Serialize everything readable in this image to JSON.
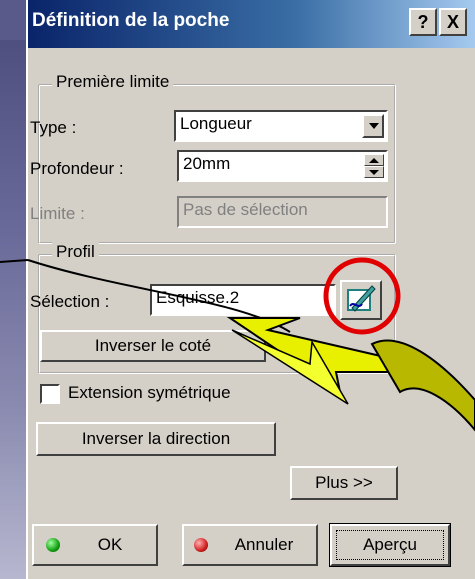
{
  "dialog": {
    "title": "Définition de la poche",
    "help_button": "?",
    "close_button": "X"
  },
  "first_limit": {
    "legend": "Première limite",
    "type_label": "Type :",
    "type_value": "Longueur",
    "depth_label": "Profondeur :",
    "depth_value": "20mm",
    "limit_label": "Limite :",
    "limit_value": "Pas de sélection"
  },
  "profile": {
    "legend": "Profil",
    "selection_label": "Sélection :",
    "selection_value": "Esquisse.2",
    "reverse_side_button": "Inverser le coté"
  },
  "options": {
    "symmetric_extension_label": "Extension symétrique",
    "symmetric_extension_checked": false,
    "reverse_direction_button": "Inverser la direction",
    "more_button": "Plus >>"
  },
  "footer": {
    "ok_button": "OK",
    "cancel_button": "Annuler",
    "preview_button": "Aperçu"
  },
  "colors": {
    "title_bar": "#0a246a",
    "dialog_face": "#d4d0c8",
    "highlight_circle": "#e00000",
    "arrow_fill": "#e8f000",
    "ok_dot": "#10a010",
    "cancel_dot": "#d02020"
  },
  "icons": {
    "sketch_button": "sketch-pencil-icon"
  }
}
